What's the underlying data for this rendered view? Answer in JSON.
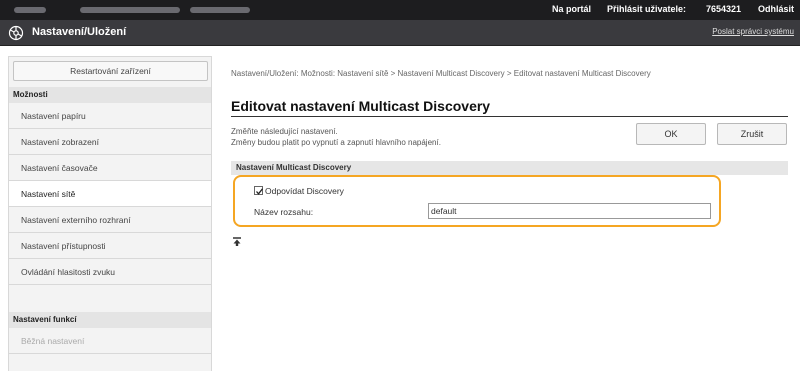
{
  "topbar": {
    "portal_label": "Na portál",
    "login_user_label": "Přihlásit uživatele:",
    "user_id": "7654321",
    "logout_label": "Odhlásit"
  },
  "header": {
    "title": "Nastavení/Uložení",
    "send_admin_link": "Poslat správci systému"
  },
  "sidebar": {
    "restart_button": "Restartování zařízení",
    "section_options": "Možnosti",
    "items": [
      {
        "label": "Nastavení papíru"
      },
      {
        "label": "Nastavení zobrazení"
      },
      {
        "label": "Nastavení časovače"
      },
      {
        "label": "Nastavení sítě"
      },
      {
        "label": "Nastavení externího rozhraní"
      },
      {
        "label": "Nastavení přístupnosti"
      },
      {
        "label": "Ovládání hlasitosti zvuku"
      }
    ],
    "section_functions": "Nastavení funkcí",
    "function_items": [
      {
        "label": "Běžná nastavení"
      }
    ]
  },
  "breadcrumb": "Nastavení/Uložení: Možnosti: Nastavení sítě > Nastavení Multicast Discovery > Editovat nastavení Multicast Discovery",
  "page": {
    "title": "Editovat nastavení Multicast Discovery",
    "desc_line1": "Změňte následující nastavení.",
    "desc_line2": "Změny budou platit po vypnutí a zapnutí hlavního napájení.",
    "ok_button": "OK",
    "cancel_button": "Zrušit"
  },
  "section": {
    "heading": "Nastavení Multicast Discovery",
    "checkbox_label": "Odpovídat Discovery",
    "checkbox_checked": true,
    "scope_label": "Název rozsahu:",
    "scope_value": "default"
  },
  "colors": {
    "highlight": "#f5a623",
    "topbar": "#1d1d1f",
    "titlebar": "#3a3a3e"
  },
  "icons": {
    "app": "gear-icon",
    "to_top": "arrow-to-top-icon"
  }
}
